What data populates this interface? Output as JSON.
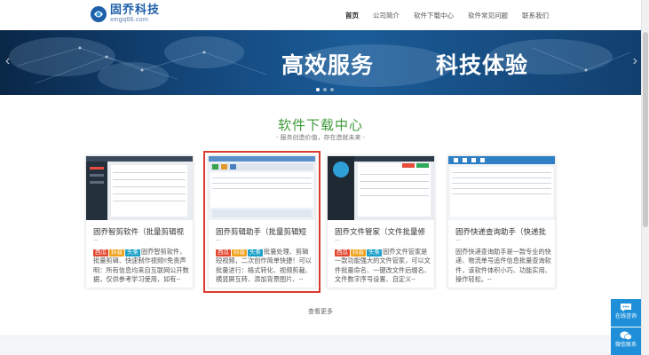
{
  "header": {
    "logo_name": "固乔科技",
    "logo_url": "xmgq66.com",
    "nav": [
      {
        "label": "首页",
        "active": true
      },
      {
        "label": "公司简介",
        "active": false
      },
      {
        "label": "软件下载中心",
        "active": false
      },
      {
        "label": "软件常见问题",
        "active": false
      },
      {
        "label": "联系我们",
        "active": false
      }
    ]
  },
  "banner": {
    "slogan_left": "高效服务",
    "slogan_right": "科技体验",
    "slide_count": 3,
    "active_slide": 1
  },
  "section": {
    "title": "软件下载中心",
    "subtitle": "- 服务创造价值，存在造就未来 -"
  },
  "cards": [
    {
      "title": "固乔智剪软件（批量剪辑视",
      "ellipsis": "...",
      "tags": [
        "西瓜",
        "抖音",
        "头条"
      ],
      "desc": "固乔智剪软件，批量剪辑、快速制作视频!!免责声明：所有信息均来自互联网公开数据，仅供参考学习使用，如有--"
    },
    {
      "title": "固乔剪辑助手（批量剪辑短",
      "ellipsis": "...",
      "tags": [
        "西瓜",
        "抖音",
        "头条"
      ],
      "desc": "批量处理、剪辑短视频，二次创作简单快捷！可以批量进行：格式转化、视频剪裁、横竖屏互转、添加背景图片、--"
    },
    {
      "title": "固乔文件管家（文件批量修",
      "ellipsis": "...",
      "tags": [
        "西瓜",
        "抖音",
        "头条"
      ],
      "desc": "固乔文件管家是一款功能强大的文件管家，可以文件批量命名、一键改文件后缀名、文件数字序号设置、自定义--"
    },
    {
      "title": "固乔快递查询助手（快递批",
      "ellipsis": "...",
      "tags": [
        "西瓜",
        "抖音",
        "头条"
      ],
      "desc": "固乔快递查询助手是一款专业的快递、物流单号追件信息批量查询软件，该软件体积小巧、功能实用、操作轻松。--"
    }
  ],
  "more_label": "查看更多",
  "float": {
    "consult_label": "在线咨询",
    "wechat_label": "微信联系"
  },
  "colors": {
    "brand": "#1d5fa8",
    "section_title": "#3f9a39",
    "highlight": "#d93b30",
    "float": "#1e8fd8"
  }
}
